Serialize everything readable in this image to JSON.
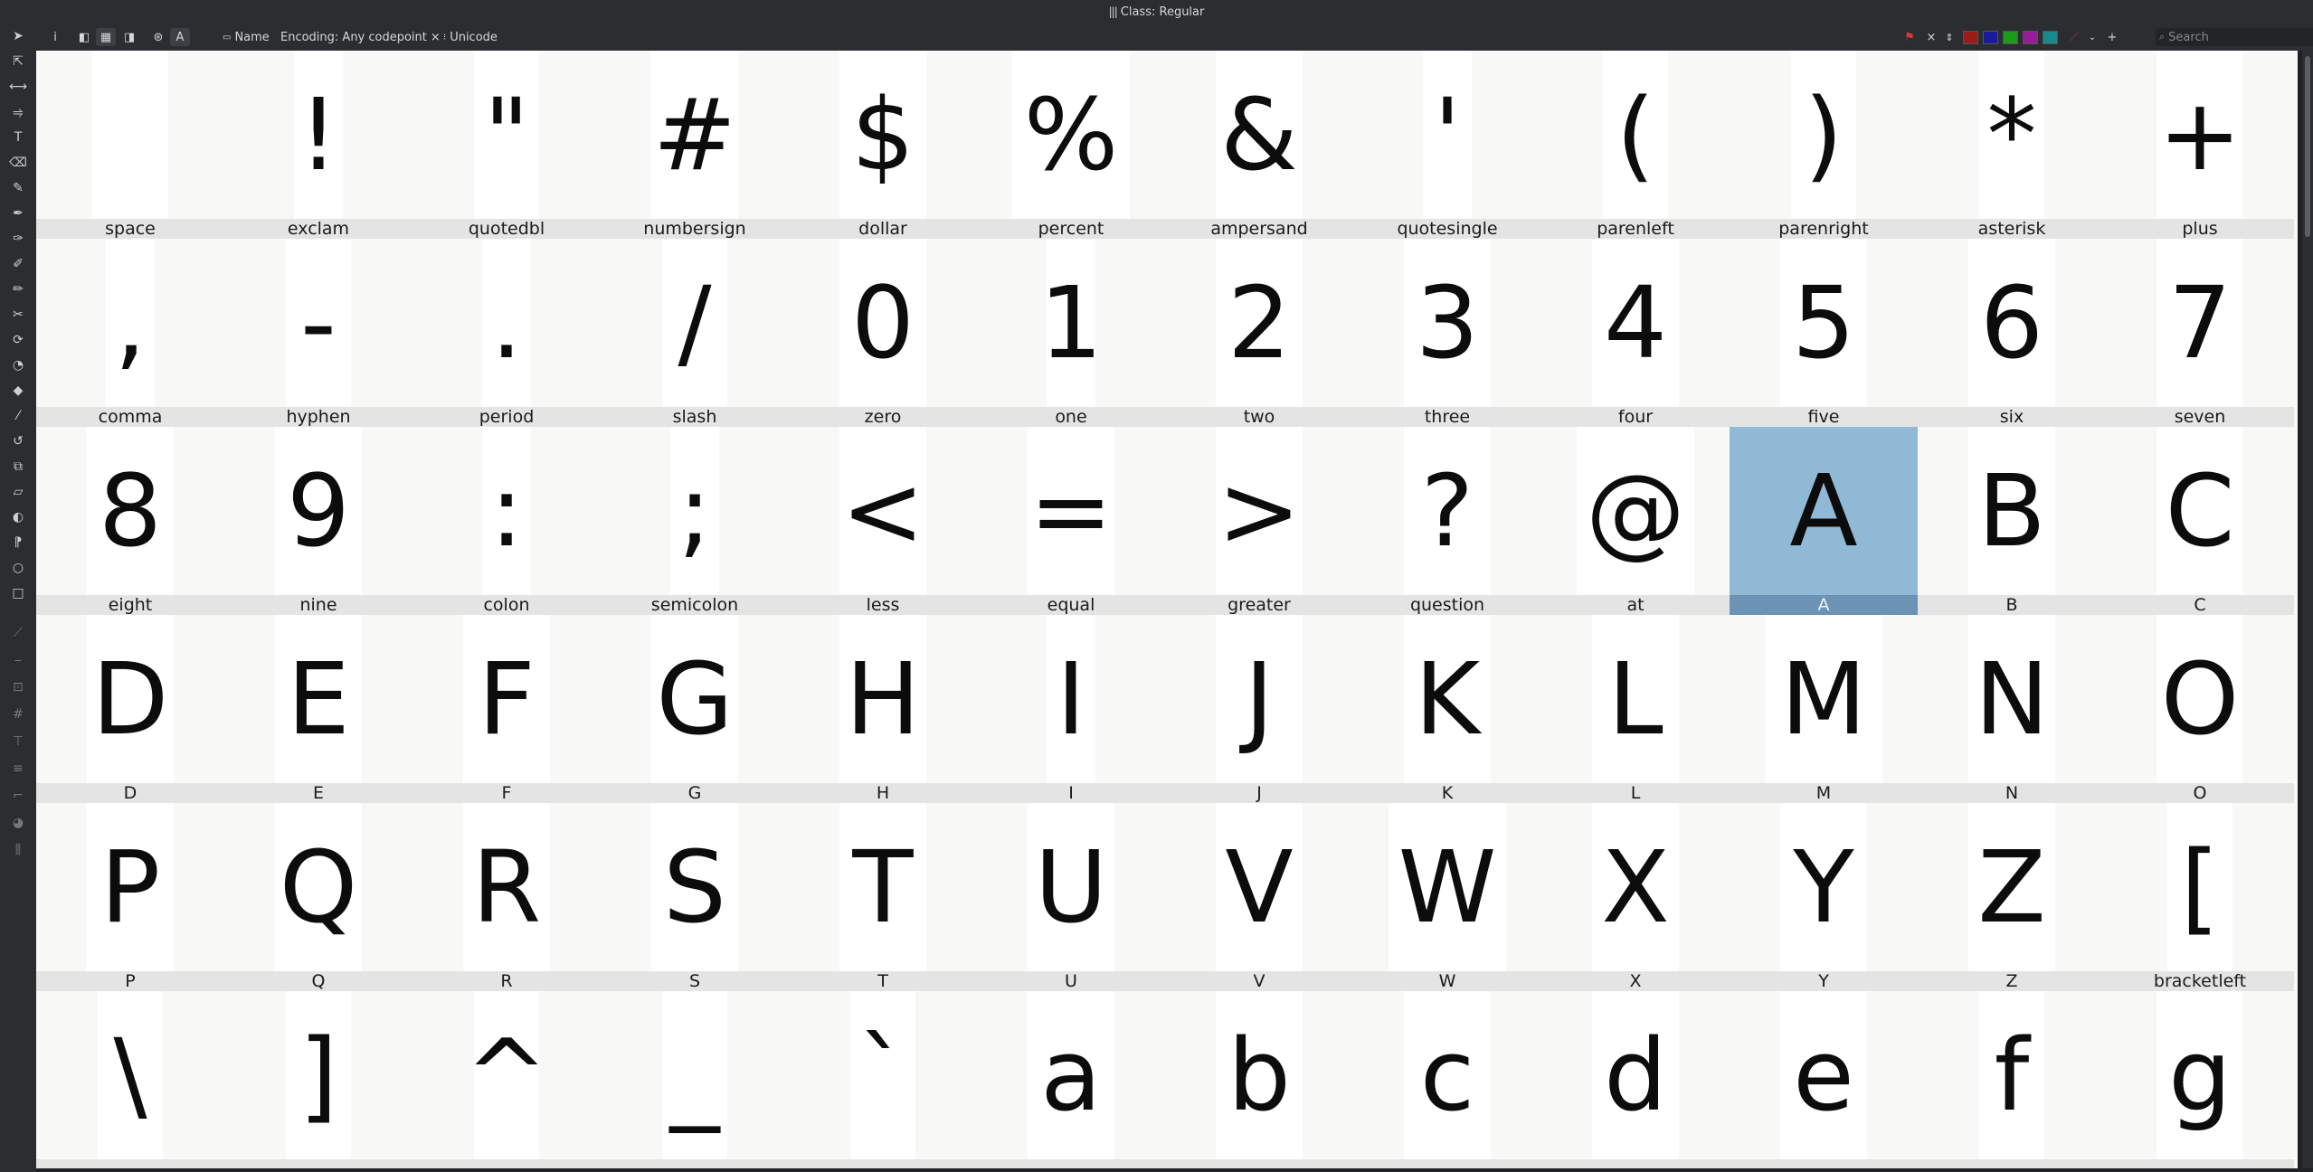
{
  "window": {
    "title": "Class: Regular"
  },
  "toolbar": {
    "info_label": "i",
    "preview_letter": "A",
    "name_label": "Name",
    "encoding_label": "Encoding: Any codepoint",
    "encoding_clear": "×",
    "unicode_label": "Unicode",
    "flag_clear": "×",
    "search_placeholder": "Search",
    "swatches": [
      "#9b1a1a",
      "#1a1a9b",
      "#1a9b1a",
      "#9b1a9b",
      "#188a8a"
    ]
  },
  "glyphs": [
    {
      "char": "",
      "name": "space"
    },
    {
      "char": "!",
      "name": "exclam"
    },
    {
      "char": "\"",
      "name": "quotedbl"
    },
    {
      "char": "#",
      "name": "numbersign"
    },
    {
      "char": "$",
      "name": "dollar"
    },
    {
      "char": "%",
      "name": "percent"
    },
    {
      "char": "&",
      "name": "ampersand"
    },
    {
      "char": "'",
      "name": "quotesingle"
    },
    {
      "char": "(",
      "name": "parenleft"
    },
    {
      "char": ")",
      "name": "parenright"
    },
    {
      "char": "*",
      "name": "asterisk"
    },
    {
      "char": "+",
      "name": "plus"
    },
    {
      "char": ",",
      "name": "comma"
    },
    {
      "char": "-",
      "name": "hyphen"
    },
    {
      "char": ".",
      "name": "period"
    },
    {
      "char": "/",
      "name": "slash"
    },
    {
      "char": "0",
      "name": "zero"
    },
    {
      "char": "1",
      "name": "one"
    },
    {
      "char": "2",
      "name": "two"
    },
    {
      "char": "3",
      "name": "three"
    },
    {
      "char": "4",
      "name": "four"
    },
    {
      "char": "5",
      "name": "five"
    },
    {
      "char": "6",
      "name": "six"
    },
    {
      "char": "7",
      "name": "seven"
    },
    {
      "char": "8",
      "name": "eight"
    },
    {
      "char": "9",
      "name": "nine"
    },
    {
      "char": ":",
      "name": "colon"
    },
    {
      "char": ";",
      "name": "semicolon"
    },
    {
      "char": "<",
      "name": "less"
    },
    {
      "char": "=",
      "name": "equal"
    },
    {
      "char": ">",
      "name": "greater"
    },
    {
      "char": "?",
      "name": "question"
    },
    {
      "char": "@",
      "name": "at"
    },
    {
      "char": "A",
      "name": "A",
      "selected": true
    },
    {
      "char": "B",
      "name": "B"
    },
    {
      "char": "C",
      "name": "C"
    },
    {
      "char": "D",
      "name": "D"
    },
    {
      "char": "E",
      "name": "E"
    },
    {
      "char": "F",
      "name": "F"
    },
    {
      "char": "G",
      "name": "G"
    },
    {
      "char": "H",
      "name": "H"
    },
    {
      "char": "I",
      "name": "I"
    },
    {
      "char": "J",
      "name": "J"
    },
    {
      "char": "K",
      "name": "K"
    },
    {
      "char": "L",
      "name": "L"
    },
    {
      "char": "M",
      "name": "M"
    },
    {
      "char": "N",
      "name": "N"
    },
    {
      "char": "O",
      "name": "O"
    },
    {
      "char": "P",
      "name": "P"
    },
    {
      "char": "Q",
      "name": "Q"
    },
    {
      "char": "R",
      "name": "R"
    },
    {
      "char": "S",
      "name": "S"
    },
    {
      "char": "T",
      "name": "T"
    },
    {
      "char": "U",
      "name": "U"
    },
    {
      "char": "V",
      "name": "V"
    },
    {
      "char": "W",
      "name": "W"
    },
    {
      "char": "X",
      "name": "X"
    },
    {
      "char": "Y",
      "name": "Y"
    },
    {
      "char": "Z",
      "name": "Z"
    },
    {
      "char": "[",
      "name": "bracketleft"
    },
    {
      "char": "\\",
      "name": ""
    },
    {
      "char": "]",
      "name": ""
    },
    {
      "char": "^",
      "name": ""
    },
    {
      "char": "_",
      "name": ""
    },
    {
      "char": "`",
      "name": ""
    },
    {
      "char": "a",
      "name": ""
    },
    {
      "char": "b",
      "name": ""
    },
    {
      "char": "c",
      "name": ""
    },
    {
      "char": "d",
      "name": ""
    },
    {
      "char": "e",
      "name": ""
    },
    {
      "char": "f",
      "name": ""
    },
    {
      "char": "g",
      "name": ""
    }
  ]
}
